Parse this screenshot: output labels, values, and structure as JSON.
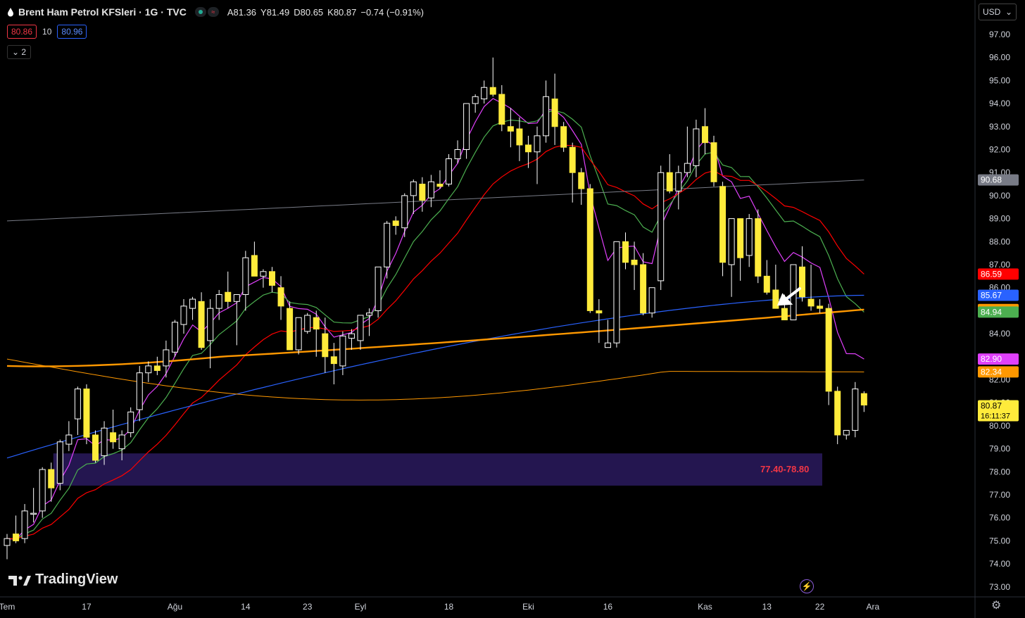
{
  "header": {
    "symbol_title": "Brent Ham Petrol KFSleri · 1G · TVC",
    "open": "A81.36",
    "high": "Y81.49",
    "low": "D80.65",
    "close": "K80.87",
    "change": "−0.74 (−0.91%)",
    "bid": "80.86",
    "spread": "10",
    "ask": "80.96",
    "collapsed_count": "2"
  },
  "currency": "USD",
  "branding": "TradingView",
  "zone_label": "77.40-78.80",
  "price_axis_labels": [
    "97.00",
    "96.00",
    "95.00",
    "94.00",
    "93.00",
    "92.00",
    "91.00",
    "90.00",
    "89.00",
    "88.00",
    "87.00",
    "86.00",
    "85.00",
    "84.00",
    "83.00",
    "82.00",
    "81.00",
    "80.00",
    "79.00",
    "78.00",
    "77.00",
    "76.00",
    "75.00",
    "74.00",
    "73.00"
  ],
  "time_axis_labels": [
    {
      "label": "Tem",
      "bar": 0
    },
    {
      "label": "17",
      "bar": 9
    },
    {
      "label": "Ağu",
      "bar": 19
    },
    {
      "label": "14",
      "bar": 27
    },
    {
      "label": "23",
      "bar": 34
    },
    {
      "label": "Eyl",
      "bar": 40
    },
    {
      "label": "18",
      "bar": 50
    },
    {
      "label": "Eki",
      "bar": 59
    },
    {
      "label": "16",
      "bar": 68
    },
    {
      "label": "Kas",
      "bar": 79
    },
    {
      "label": "13",
      "bar": 86
    },
    {
      "label": "22",
      "bar": 92
    },
    {
      "label": "Ara",
      "bar": 98
    }
  ],
  "price_tags": [
    {
      "value": "90.68",
      "color": "#787b86",
      "text_color": "#ffffff"
    },
    {
      "value": "86.59",
      "color": "#ff0000",
      "text_color": "#ffffff"
    },
    {
      "value": "85.67",
      "color": "#2962ff",
      "text_color": "#ffffff"
    },
    {
      "value": "85.05",
      "color": "#ff9800",
      "text_color": "#ffffff"
    },
    {
      "value": "84.94",
      "color": "#4caf50",
      "text_color": "#ffffff"
    },
    {
      "value": "82.90",
      "color": "#e040fb",
      "text_color": "#ffffff"
    },
    {
      "value": "82.34",
      "color": "#ff9800",
      "text_color": "#ffffff"
    },
    {
      "value": "80.87",
      "color": "#ffeb3b",
      "text_color": "#000000",
      "sub": "16:11:37"
    }
  ],
  "colors": {
    "up_body": "#ffffff",
    "down_body": "#ffeb3b",
    "zone_fill": "#2a1a5e",
    "arrow": "#ffffff"
  },
  "chart_data": {
    "type": "candlestick",
    "title": "Brent Ham Petrol KFSleri · 1G · TVC",
    "ylim": [
      72.6,
      98.0
    ],
    "ohlc": [
      [
        74.8,
        75.3,
        74.2,
        75.1
      ],
      [
        75.3,
        76.1,
        74.9,
        75.0
      ],
      [
        75.1,
        76.6,
        74.9,
        76.3
      ],
      [
        76.2,
        77.3,
        75.8,
        76.2
      ],
      [
        76.3,
        78.2,
        76.0,
        78.1
      ],
      [
        78.1,
        78.4,
        76.7,
        77.3
      ],
      [
        77.5,
        79.4,
        77.2,
        79.3
      ],
      [
        79.2,
        80.2,
        78.9,
        79.6
      ],
      [
        80.3,
        81.7,
        79.6,
        81.6
      ],
      [
        81.6,
        81.8,
        79.2,
        79.5
      ],
      [
        79.6,
        79.8,
        78.4,
        78.5
      ],
      [
        78.7,
        80.2,
        78.3,
        79.9
      ],
      [
        79.7,
        80.7,
        79.0,
        79.3
      ],
      [
        79.0,
        79.8,
        78.5,
        79.6
      ],
      [
        79.7,
        80.8,
        79.5,
        80.6
      ],
      [
        80.7,
        82.6,
        80.2,
        82.3
      ],
      [
        82.3,
        82.8,
        81.9,
        82.6
      ],
      [
        82.6,
        83.0,
        82.2,
        82.4
      ],
      [
        82.6,
        83.7,
        82.1,
        83.3
      ],
      [
        83.2,
        84.6,
        83.0,
        84.5
      ],
      [
        84.4,
        85.5,
        84.0,
        85.2
      ],
      [
        85.1,
        85.6,
        84.6,
        85.5
      ],
      [
        85.4,
        85.8,
        83.3,
        83.4
      ],
      [
        83.7,
        85.5,
        82.5,
        85.1
      ],
      [
        85.1,
        85.9,
        84.6,
        85.7
      ],
      [
        85.8,
        86.7,
        85.1,
        85.4
      ],
      [
        85.4,
        85.6,
        83.5,
        85.7
      ],
      [
        85.7,
        87.6,
        85.0,
        87.3
      ],
      [
        87.4,
        88.0,
        86.7,
        86.5
      ],
      [
        86.5,
        86.8,
        86.0,
        86.7
      ],
      [
        86.7,
        86.9,
        85.8,
        86.1
      ],
      [
        86.0,
        86.5,
        84.6,
        85.2
      ],
      [
        85.1,
        85.4,
        84.0,
        83.3
      ],
      [
        83.3,
        84.6,
        83.1,
        84.7
      ],
      [
        84.1,
        84.9,
        84.0,
        84.8
      ],
      [
        84.7,
        85.0,
        83.0,
        84.2
      ],
      [
        84.0,
        84.7,
        82.3,
        83.0
      ],
      [
        83.0,
        83.6,
        81.8,
        82.7
      ],
      [
        82.6,
        84.1,
        82.2,
        83.9
      ],
      [
        83.8,
        84.2,
        83.3,
        84.0
      ],
      [
        83.7,
        84.4,
        83.3,
        84.8
      ],
      [
        84.8,
        85.1,
        83.9,
        84.9
      ],
      [
        85.0,
        86.3,
        84.7,
        86.9
      ],
      [
        86.9,
        88.9,
        86.4,
        88.8
      ],
      [
        88.9,
        89.1,
        88.3,
        88.7
      ],
      [
        88.6,
        90.1,
        88.2,
        90.0
      ],
      [
        90.0,
        90.7,
        89.2,
        90.6
      ],
      [
        90.5,
        90.8,
        89.3,
        89.8
      ],
      [
        89.9,
        90.9,
        89.5,
        90.6
      ],
      [
        90.5,
        91.1,
        90.3,
        90.4
      ],
      [
        90.5,
        91.8,
        90.4,
        91.6
      ],
      [
        91.6,
        92.4,
        91.4,
        92.0
      ],
      [
        92.0,
        94.0,
        91.6,
        94.0
      ],
      [
        94.0,
        94.4,
        93.6,
        94.3
      ],
      [
        94.2,
        95.0,
        94.0,
        94.7
      ],
      [
        94.7,
        96.0,
        94.3,
        94.4
      ],
      [
        94.4,
        94.8,
        92.8,
        93.1
      ],
      [
        93.0,
        93.8,
        92.1,
        92.8
      ],
      [
        92.9,
        93.4,
        91.5,
        92.2
      ],
      [
        92.2,
        92.6,
        91.2,
        91.9
      ],
      [
        91.9,
        93.0,
        90.5,
        92.6
      ],
      [
        92.6,
        95.0,
        92.3,
        94.3
      ],
      [
        94.2,
        95.3,
        92.2,
        93.0
      ],
      [
        93.0,
        93.2,
        91.9,
        92.1
      ],
      [
        92.1,
        92.3,
        89.7,
        91.0
      ],
      [
        91.0,
        91.2,
        89.6,
        90.3
      ],
      [
        90.3,
        90.5,
        84.9,
        85.0
      ],
      [
        85.0,
        85.5,
        83.6,
        84.9
      ],
      [
        83.4,
        84.6,
        83.5,
        83.6
      ],
      [
        83.6,
        85.2,
        83.4,
        88.0
      ],
      [
        88.0,
        88.4,
        86.8,
        87.1
      ],
      [
        87.2,
        88.0,
        85.9,
        87.0
      ],
      [
        87.0,
        87.5,
        84.8,
        84.9
      ],
      [
        84.9,
        85.0,
        84.7,
        86.0
      ],
      [
        86.3,
        91.3,
        85.9,
        91.0
      ],
      [
        91.0,
        91.8,
        90.1,
        90.2
      ],
      [
        90.2,
        91.3,
        89.4,
        91.0
      ],
      [
        91.0,
        93.0,
        90.8,
        91.4
      ],
      [
        91.3,
        93.3,
        90.8,
        92.9
      ],
      [
        93.0,
        93.8,
        91.8,
        92.3
      ],
      [
        92.3,
        92.6,
        90.4,
        90.6
      ],
      [
        90.4,
        90.6,
        86.5,
        87.1
      ],
      [
        87.0,
        88.5,
        85.6,
        89.0
      ],
      [
        89.0,
        88.9,
        86.3,
        87.3
      ],
      [
        87.4,
        89.2,
        86.9,
        89.0
      ],
      [
        89.0,
        89.4,
        86.2,
        86.5
      ],
      [
        86.5,
        87.2,
        85.7,
        85.8
      ],
      [
        85.9,
        87.0,
        85.4,
        85.1
      ],
      [
        85.1,
        85.7,
        84.6,
        84.6
      ],
      [
        84.6,
        86.9,
        84.6,
        87.0
      ],
      [
        86.9,
        87.8,
        85.4,
        85.6
      ],
      [
        85.5,
        87.0,
        85.0,
        85.2
      ],
      [
        85.2,
        85.5,
        84.9,
        85.1
      ],
      [
        85.1,
        85.3,
        80.9,
        81.5
      ],
      [
        81.5,
        81.7,
        79.2,
        79.6
      ],
      [
        79.6,
        79.8,
        79.4,
        79.8
      ],
      [
        79.8,
        81.9,
        79.5,
        81.6
      ],
      [
        81.4,
        81.5,
        80.6,
        80.9
      ]
    ],
    "moving_averages": [
      {
        "color": "#e040fb",
        "last": 82.9
      },
      {
        "color": "#4caf50",
        "last": 84.94
      },
      {
        "color": "#ff0000",
        "last": 86.59
      },
      {
        "color": "#2962ff",
        "last": 85.67
      },
      {
        "color": "#ff9800",
        "last": 85.05
      },
      {
        "color": "#ff9800",
        "last": 82.34
      },
      {
        "color": "#787b86",
        "last": 90.68
      }
    ],
    "zone": [
      77.4,
      78.8
    ]
  }
}
